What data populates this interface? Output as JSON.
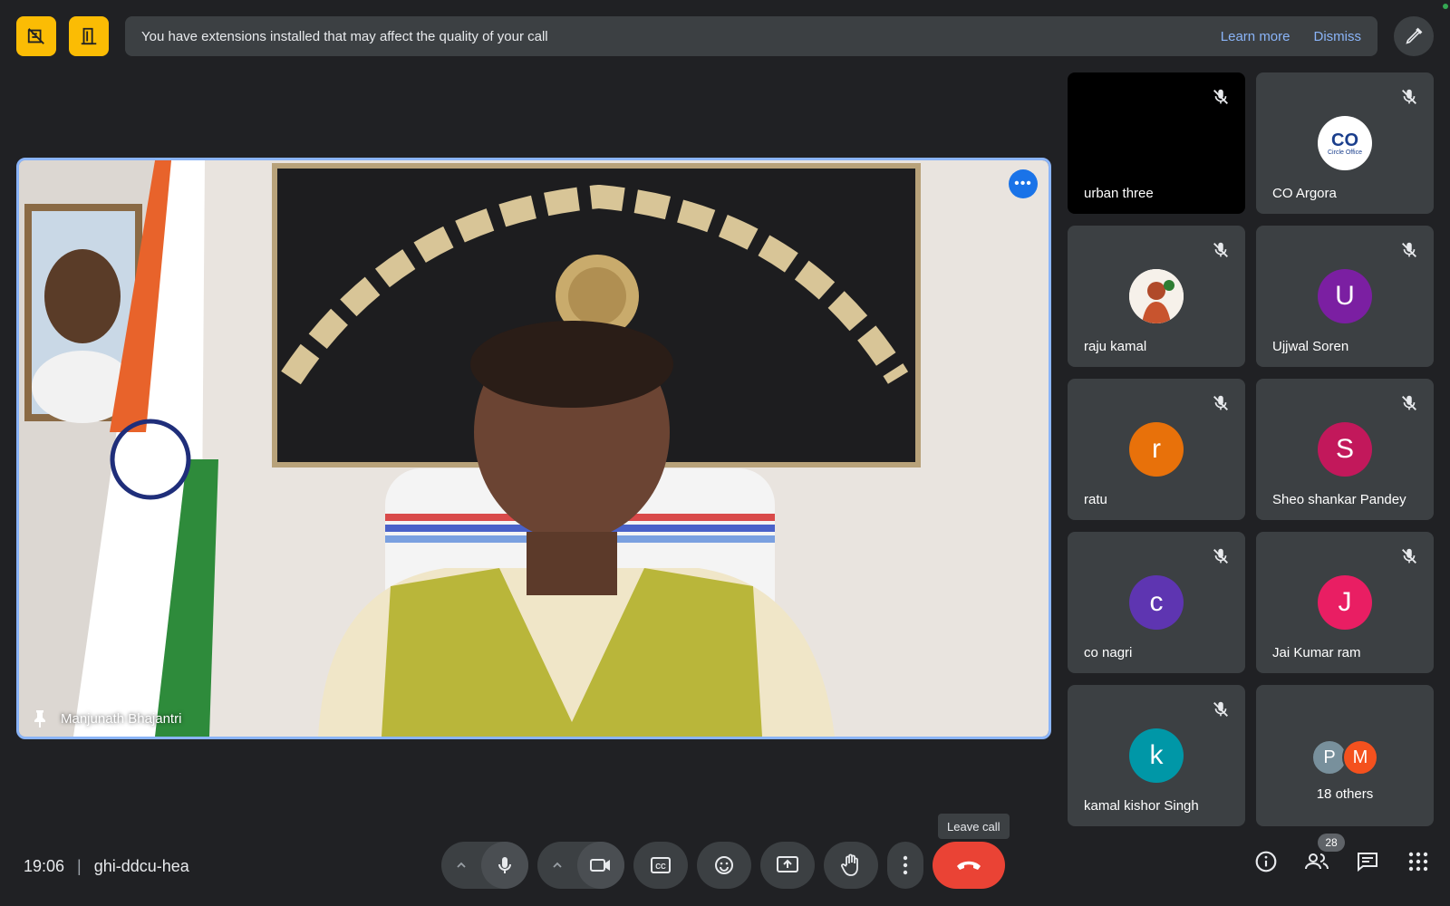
{
  "banner": {
    "message": "You have extensions installed that may affect the quality of your call",
    "learn_more": "Learn more",
    "dismiss": "Dismiss"
  },
  "main": {
    "name": "Manjunath Bhajantri"
  },
  "tiles": [
    {
      "name": "urban three"
    },
    {
      "name": "CO Argora",
      "avatar_logo": "CO",
      "avatar_sub": "Circle Office"
    },
    {
      "name": "raju kamal"
    },
    {
      "name": "Ujjwal Soren",
      "initial": "U"
    },
    {
      "name": "ratu",
      "initial": "r"
    },
    {
      "name": "Sheo shankar Pandey",
      "initial": "S"
    },
    {
      "name": "co nagri",
      "initial": "c"
    },
    {
      "name": "Jai Kumar ram",
      "initial": "J"
    },
    {
      "name": "kamal kishor Singh",
      "initial": "k"
    }
  ],
  "others": {
    "initial_1": "P",
    "initial_2": "M",
    "label": "18 others"
  },
  "meeting": {
    "time": "19:06",
    "code": "ghi-ddcu-hea"
  },
  "tooltip": "Leave call",
  "participants_count": "28",
  "colors": {
    "background": "#202124",
    "tile": "#3c4043",
    "accent": "#8ab4f8",
    "leave": "#ea4335",
    "extension": "#fbbc04",
    "avatar_U": "#7b1fa2",
    "avatar_r": "#e8710a",
    "avatar_S": "#c2185b",
    "avatar_c": "#5e35b1",
    "avatar_J": "#e91e63",
    "avatar_k": "#0097a7",
    "avatar_P": "#78909c",
    "avatar_M": "#f4511e"
  }
}
